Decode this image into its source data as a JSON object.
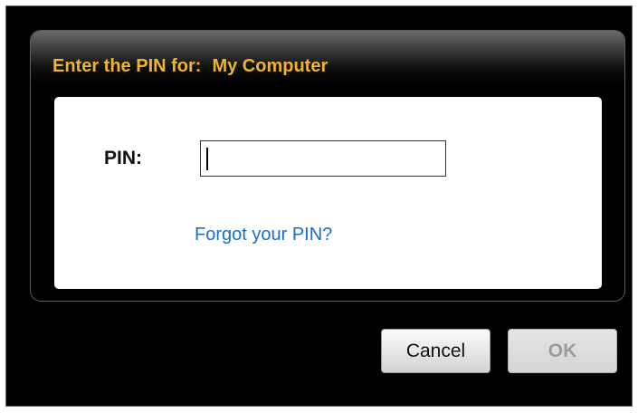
{
  "dialog": {
    "title_prefix": "Enter the PIN for:",
    "title_target": "My Computer",
    "pin_label": "PIN:",
    "pin_value": "",
    "forgot_link": "Forgot your PIN?",
    "cancel_label": "Cancel",
    "ok_label": "OK",
    "ok_enabled": false
  },
  "colors": {
    "title": "#f0b42a",
    "link": "#1a6ec8",
    "background": "#000000"
  }
}
